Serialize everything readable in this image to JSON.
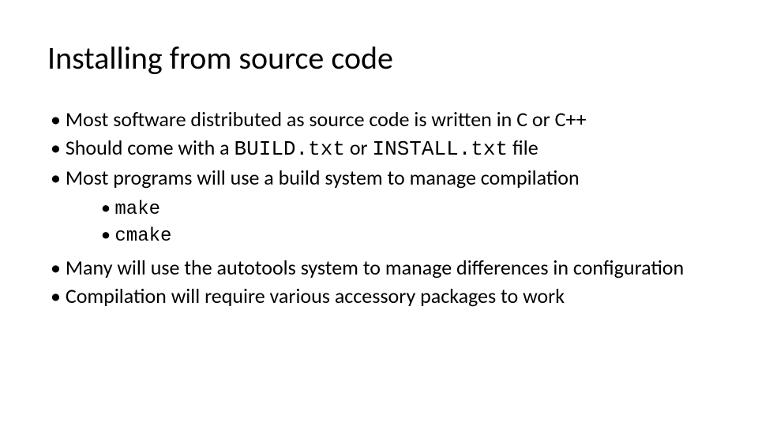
{
  "title": "Installing from source code",
  "bullets": {
    "b1": "Most software distributed as source code is written in C or C++",
    "b2_pre": "Should come with a ",
    "b2_code1": "BUILD.txt",
    "b2_mid": " or ",
    "b2_code2": "INSTALL.txt",
    "b2_post": " file",
    "b3": "Most programs will use a build system to manage compilation",
    "sub1": "make",
    "sub2": "cmake",
    "b4": "Many will use the autotools system to manage differences in configuration",
    "b5": "Compilation will require various accessory packages to work"
  }
}
